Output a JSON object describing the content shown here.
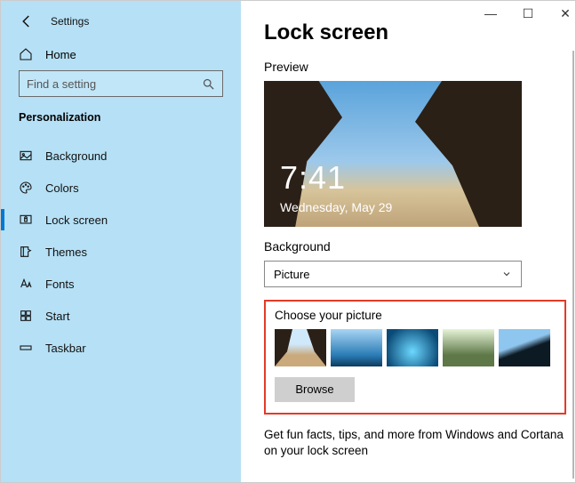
{
  "window": {
    "title": "Settings"
  },
  "sidebar": {
    "home": "Home",
    "search_placeholder": "Find a setting",
    "section": "Personalization",
    "items": [
      {
        "label": "Background"
      },
      {
        "label": "Colors"
      },
      {
        "label": "Lock screen"
      },
      {
        "label": "Themes"
      },
      {
        "label": "Fonts"
      },
      {
        "label": "Start"
      },
      {
        "label": "Taskbar"
      }
    ]
  },
  "main": {
    "title": "Lock screen",
    "preview_label": "Preview",
    "clock_time": "7:41",
    "clock_date": "Wednesday, May 29",
    "background_label": "Background",
    "background_value": "Picture",
    "choose_label": "Choose your picture",
    "browse_label": "Browse",
    "footer": "Get fun facts, tips, and more from Windows and Cortana on your lock screen"
  }
}
